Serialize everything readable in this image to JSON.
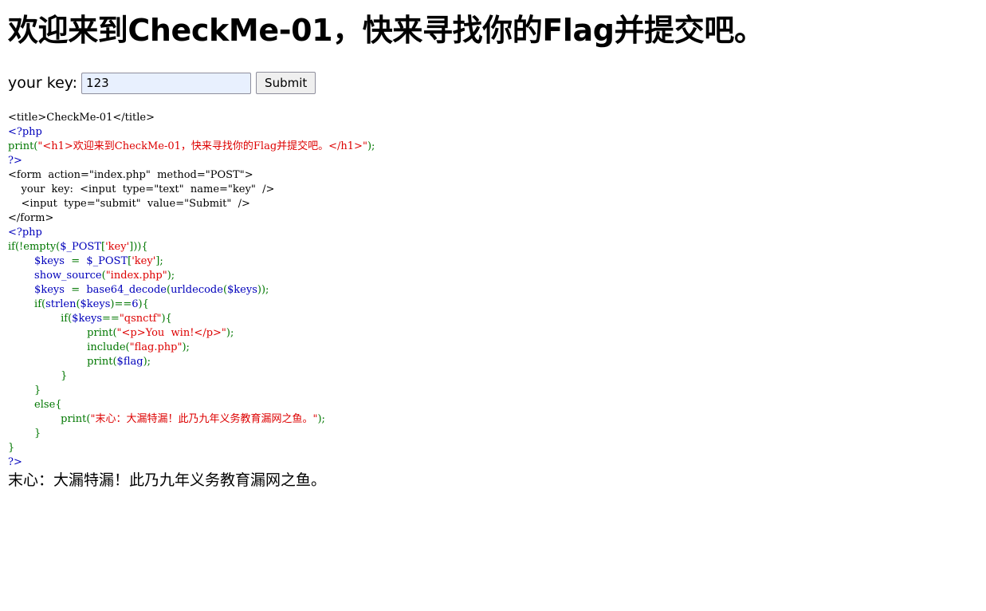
{
  "heading": "欢迎来到CheckMe-01，快来寻找你的Flag并提交吧。",
  "form": {
    "label": "your key:",
    "input_value": "123",
    "submit_label": "Submit"
  },
  "source_colors": {
    "html": "#000000",
    "keyword": "#007700",
    "string": "#dd0000",
    "default": "#0000bb"
  },
  "source_lines": [
    [
      {
        "c": "html",
        "t": "<title>CheckMe-01</title>"
      }
    ],
    [
      {
        "c": "var",
        "t": "<?php"
      }
    ],
    [
      {
        "c": "def",
        "t": "print("
      },
      {
        "c": "str",
        "t": "\"<h1>欢迎来到CheckMe-01，快来寻找你的Flag并提交吧。</h1>\""
      },
      {
        "c": "def",
        "t": ");"
      }
    ],
    [
      {
        "c": "var",
        "t": "?>"
      }
    ],
    [
      {
        "c": "html",
        "t": "<form  action=\"index.php\"  method=\"POST\">"
      }
    ],
    [
      {
        "c": "html",
        "t": "    your  key:  <input  type=\"text\"  name=\"key\"  />"
      }
    ],
    [
      {
        "c": "html",
        "t": "    <input  type=\"submit\"  value=\"Submit\"  />"
      }
    ],
    [
      {
        "c": "html",
        "t": "</form>"
      }
    ],
    [
      {
        "c": "var",
        "t": "<?php"
      }
    ],
    [
      {
        "c": "def",
        "t": "if(!empty("
      },
      {
        "c": "var",
        "t": "$_POST"
      },
      {
        "c": "def",
        "t": "["
      },
      {
        "c": "str",
        "t": "'key'"
      },
      {
        "c": "def",
        "t": "])){"
      }
    ],
    [
      {
        "c": "var",
        "t": "        $keys  "
      },
      {
        "c": "def",
        "t": "=  "
      },
      {
        "c": "var",
        "t": "$_POST"
      },
      {
        "c": "def",
        "t": "["
      },
      {
        "c": "str",
        "t": "'key'"
      },
      {
        "c": "def",
        "t": "];"
      }
    ],
    [
      {
        "c": "var",
        "t": "        show_source"
      },
      {
        "c": "def",
        "t": "("
      },
      {
        "c": "str",
        "t": "\"index.php\""
      },
      {
        "c": "def",
        "t": ");"
      }
    ],
    [
      {
        "c": "var",
        "t": "        $keys  "
      },
      {
        "c": "def",
        "t": "=  "
      },
      {
        "c": "var",
        "t": "base64_decode"
      },
      {
        "c": "def",
        "t": "("
      },
      {
        "c": "var",
        "t": "urldecode"
      },
      {
        "c": "def",
        "t": "("
      },
      {
        "c": "var",
        "t": "$keys"
      },
      {
        "c": "def",
        "t": "));"
      }
    ],
    [
      {
        "c": "def",
        "t": "        if("
      },
      {
        "c": "var",
        "t": "strlen"
      },
      {
        "c": "def",
        "t": "("
      },
      {
        "c": "var",
        "t": "$keys"
      },
      {
        "c": "def",
        "t": ")=="
      },
      {
        "c": "var",
        "t": "6"
      },
      {
        "c": "def",
        "t": "){"
      }
    ],
    [
      {
        "c": "def",
        "t": "                if("
      },
      {
        "c": "var",
        "t": "$keys"
      },
      {
        "c": "def",
        "t": "=="
      },
      {
        "c": "str",
        "t": "\"qsnctf\""
      },
      {
        "c": "def",
        "t": "){"
      }
    ],
    [
      {
        "c": "def",
        "t": "                        print("
      },
      {
        "c": "str",
        "t": "\"<p>You  win!</p>\""
      },
      {
        "c": "def",
        "t": ");"
      }
    ],
    [
      {
        "c": "def",
        "t": "                        include("
      },
      {
        "c": "str",
        "t": "\"flag.php\""
      },
      {
        "c": "def",
        "t": ");"
      }
    ],
    [
      {
        "c": "def",
        "t": "                        print("
      },
      {
        "c": "var",
        "t": "$flag"
      },
      {
        "c": "def",
        "t": ");"
      }
    ],
    [
      {
        "c": "def",
        "t": "                }"
      }
    ],
    [
      {
        "c": "def",
        "t": "        }"
      }
    ],
    [
      {
        "c": "def",
        "t": "        else{"
      }
    ],
    [
      {
        "c": "def",
        "t": "                print("
      },
      {
        "c": "str",
        "t": "\"末心：大漏特漏！此乃九年义务教育漏网之鱼。\""
      },
      {
        "c": "def",
        "t": ");"
      }
    ],
    [
      {
        "c": "def",
        "t": "        }"
      }
    ],
    [
      {
        "c": "def",
        "t": "}"
      }
    ],
    [
      {
        "c": "var",
        "t": "?>"
      }
    ]
  ],
  "output_text": "末心：大漏特漏！此乃九年义务教育漏网之鱼。"
}
